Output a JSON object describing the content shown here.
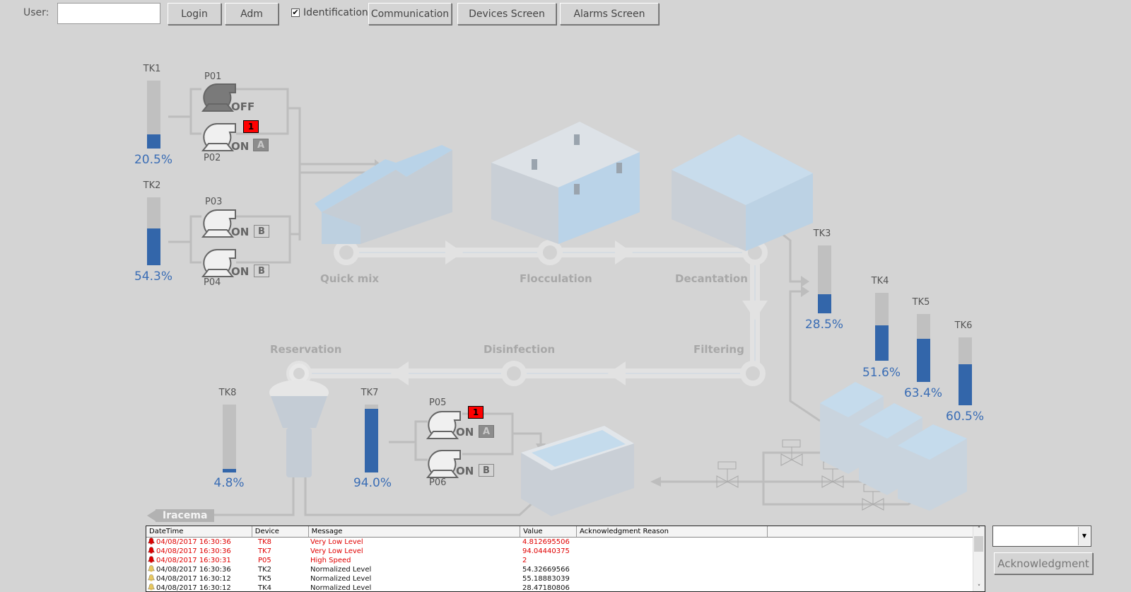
{
  "toolbar": {
    "user_label": "User:",
    "user_value": "",
    "login": "Login",
    "adm": "Adm",
    "identification_label": "Identification",
    "identification_checked": true,
    "communication": "Communication",
    "devices_screen": "Devices Screen",
    "alarms_screen": "Alarms Screen"
  },
  "tanks": {
    "TK1": {
      "name": "TK1",
      "level": 20.5,
      "label": "20.5%"
    },
    "TK2": {
      "name": "TK2",
      "level": 54.3,
      "label": "54.3%"
    },
    "TK3": {
      "name": "TK3",
      "level": 28.5,
      "label": "28.5%"
    },
    "TK4": {
      "name": "TK4",
      "level": 51.6,
      "label": "51.6%"
    },
    "TK5": {
      "name": "TK5",
      "level": 63.4,
      "label": "63.4%"
    },
    "TK6": {
      "name": "TK6",
      "level": 60.5,
      "label": "60.5%"
    },
    "TK7": {
      "name": "TK7",
      "level": 94.0,
      "label": "94.0%"
    },
    "TK8": {
      "name": "TK8",
      "level": 4.8,
      "label": "4.8%"
    }
  },
  "pumps": {
    "P01": {
      "name": "P01",
      "state": "OFF",
      "mode": "",
      "alarm": ""
    },
    "P02": {
      "name": "P02",
      "state": "ON",
      "mode": "A",
      "alarm": "1"
    },
    "P03": {
      "name": "P03",
      "state": "ON",
      "mode": "B",
      "alarm": ""
    },
    "P04": {
      "name": "P04",
      "state": "ON",
      "mode": "B",
      "alarm": ""
    },
    "P05": {
      "name": "P05",
      "state": "ON",
      "mode": "A",
      "alarm": "1"
    },
    "P06": {
      "name": "P06",
      "state": "ON",
      "mode": "B",
      "alarm": ""
    }
  },
  "stages": {
    "quick_mix": "Quick mix",
    "flocculation": "Flocculation",
    "decantation": "Decantation",
    "filtering": "Filtering",
    "disinfection": "Disinfection",
    "reservation": "Reservation"
  },
  "outlet_label": "Iracema",
  "alarm_table": {
    "columns": [
      "DateTime",
      "Device",
      "Message",
      "Value",
      "Acknowledgment Reason",
      ""
    ],
    "rows": [
      {
        "datetime": "04/08/2017 16:30:36",
        "device": "TK8",
        "message": "Very Low Level",
        "value": "4.812695506",
        "reason": "",
        "severity": "critical"
      },
      {
        "datetime": "04/08/2017 16:30:36",
        "device": "TK7",
        "message": "Very Low Level",
        "value": "94.04440375",
        "reason": "",
        "severity": "critical"
      },
      {
        "datetime": "04/08/2017 16:30:31",
        "device": "P05",
        "message": "High Speed",
        "value": "2",
        "reason": "",
        "severity": "critical"
      },
      {
        "datetime": "04/08/2017 16:30:36",
        "device": "TK2",
        "message": "Normalized Level",
        "value": "54.32669566",
        "reason": "",
        "severity": "normal"
      },
      {
        "datetime": "04/08/2017 16:30:12",
        "device": "TK5",
        "message": "Normalized Level",
        "value": "55.18883039",
        "reason": "",
        "severity": "normal"
      },
      {
        "datetime": "04/08/2017 16:30:12",
        "device": "TK4",
        "message": "Normalized Level",
        "value": "28.47180806",
        "reason": "",
        "severity": "normal"
      }
    ]
  },
  "ack_reason_select": "",
  "ack_button": "Acknowledgment",
  "colors": {
    "tank_fill": "#3366aa",
    "tank_empty": "#c0c0c0",
    "alarm_red": "#ff0000",
    "critical_text": "#e00000",
    "background": "#d4d4d4"
  }
}
